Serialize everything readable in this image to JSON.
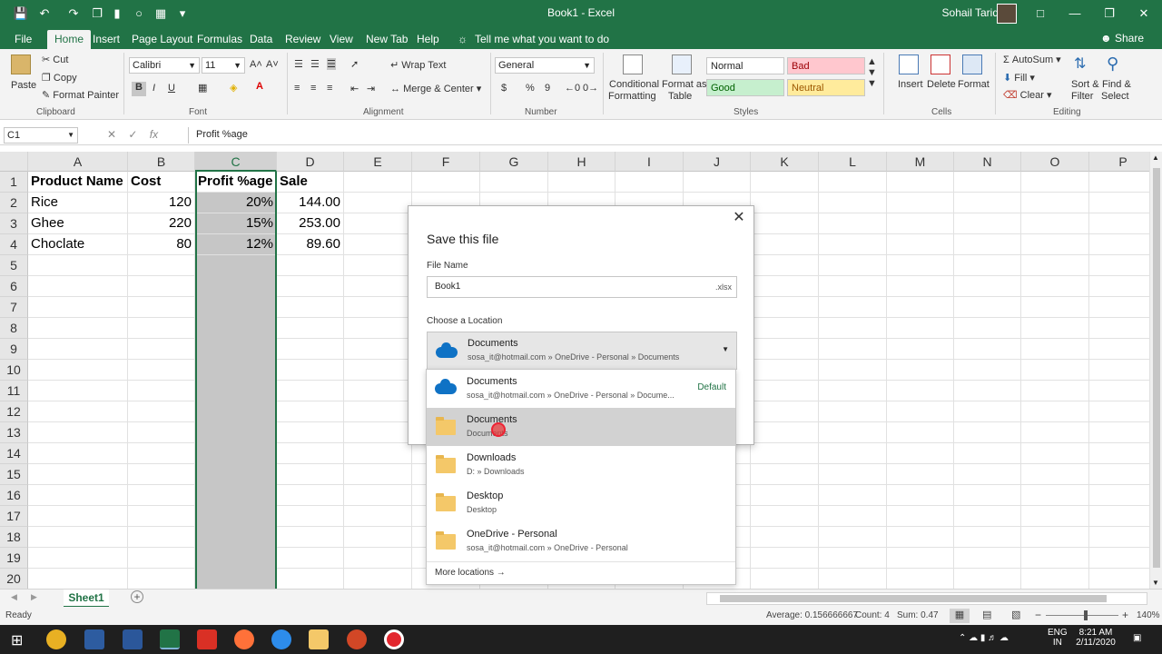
{
  "titlebar": {
    "title": "Book1 - Excel",
    "user": "Sohail Tariq"
  },
  "tabs": [
    "File",
    "Home",
    "Insert",
    "Page Layout",
    "Formulas",
    "Data",
    "Review",
    "View",
    "New Tab",
    "Help"
  ],
  "tell_me": "Tell me what you want to do",
  "share": "Share",
  "ribbon": {
    "clipboard": {
      "paste": "Paste",
      "cut": "Cut",
      "copy": "Copy",
      "format_painter": "Format Painter",
      "label": "Clipboard"
    },
    "font": {
      "name": "Calibri",
      "size": "11",
      "label": "Font",
      "bold": "B",
      "italic": "I",
      "underline": "U"
    },
    "alignment": {
      "wrap": "Wrap Text",
      "merge": "Merge & Center",
      "label": "Alignment"
    },
    "number": {
      "format": "General",
      "label": "Number",
      "currency": "$",
      "percent": "%",
      "comma": "9"
    },
    "styles": {
      "conditional": "Conditional",
      "formatting": "Formatting",
      "format_as": "Format as",
      "table": "Table",
      "normal": "Normal",
      "bad": "Bad",
      "good": "Good",
      "neutral": "Neutral",
      "label": "Styles"
    },
    "cells": {
      "insert": "Insert",
      "delete": "Delete",
      "format": "Format",
      "label": "Cells"
    },
    "editing": {
      "autosum": "AutoSum",
      "fill": "Fill",
      "clear": "Clear",
      "sort": "Sort &",
      "filter": "Filter",
      "find": "Find &",
      "select": "Select",
      "label": "Editing"
    }
  },
  "formula_bar": {
    "name_box": "C1",
    "content": "Profit %age"
  },
  "columns": [
    "A",
    "B",
    "C",
    "D",
    "E",
    "F",
    "G",
    "H",
    "I",
    "J",
    "K",
    "L",
    "M",
    "N",
    "O",
    "P"
  ],
  "rows": [
    "1",
    "2",
    "3",
    "4",
    "5",
    "6",
    "7",
    "8",
    "9",
    "10",
    "11",
    "12",
    "13",
    "14",
    "15",
    "16",
    "17",
    "18",
    "19",
    "20"
  ],
  "table": {
    "headers": [
      "Product Name",
      "Cost",
      "Profit %age",
      "Sale"
    ],
    "data": [
      [
        "Rice",
        "120",
        "20%",
        "144.00"
      ],
      [
        "Ghee",
        "220",
        "15%",
        "253.00"
      ],
      [
        "Choclate",
        "80",
        "12%",
        "89.60"
      ]
    ]
  },
  "dialog": {
    "title": "Save this file",
    "file_name_label": "File Name",
    "file_name": "Book1",
    "extension": ".xlsx",
    "location_label": "Choose a Location",
    "selected": {
      "name": "Documents",
      "path": "sosa_it@hotmail.com » OneDrive - Personal » Documents"
    }
  },
  "locations": [
    {
      "name": "Documents",
      "path": "sosa_it@hotmail.com » OneDrive - Personal » Docume...",
      "badge": "Default",
      "icon": "cloud-icon"
    },
    {
      "name": "Documents",
      "path": "Documents",
      "icon": "folder-icon"
    },
    {
      "name": "Downloads",
      "path": "D: » Downloads",
      "icon": "folder-icon"
    },
    {
      "name": "Desktop",
      "path": "Desktop",
      "icon": "folder-icon"
    },
    {
      "name": "OneDrive - Personal",
      "path": "sosa_it@hotmail.com » OneDrive - Personal",
      "icon": "folder-icon"
    }
  ],
  "more_locations": "More locations →",
  "sheet": {
    "tab": "Sheet1"
  },
  "status": {
    "ready": "Ready",
    "average": "Average: 0.156666667",
    "count": "Count: 4",
    "sum": "Sum: 0.47",
    "zoom": "140%"
  },
  "taskbar": {
    "lang1": "ENG",
    "lang2": "IN",
    "time": "8:21 AM",
    "date": "2/11/2020"
  },
  "colors": {
    "excel_green": "#217346",
    "selection_fill": "#c6c6c6",
    "folder": "#f4c869",
    "onedrive": "#0f72c5"
  }
}
